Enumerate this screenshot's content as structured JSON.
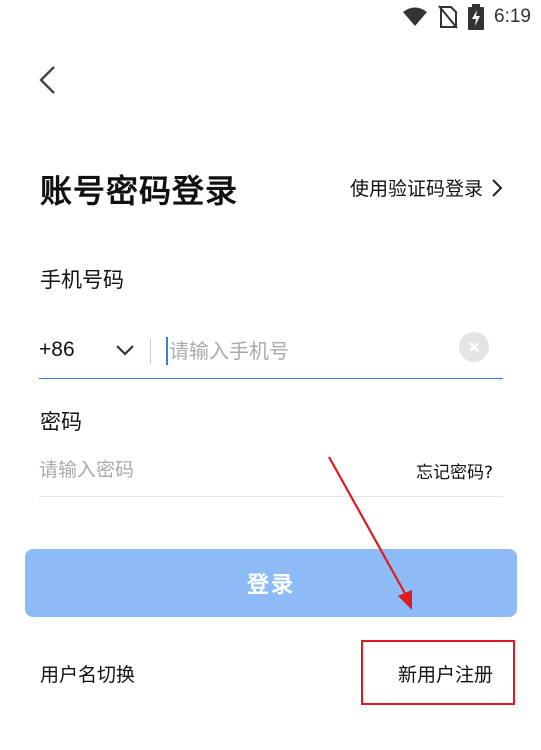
{
  "status_bar": {
    "time": "6:19"
  },
  "page": {
    "title": "账号密码登录",
    "alt_login": "使用验证码登录"
  },
  "phone": {
    "label": "手机号码",
    "country_code": "+86",
    "placeholder": "请输入手机号",
    "value": ""
  },
  "password": {
    "label": "密码",
    "placeholder": "请输入密码",
    "forgot": "忘记密码?"
  },
  "login_button": "登录",
  "footer": {
    "switch_user": "用户名切换",
    "register": "新用户注册"
  },
  "colors": {
    "accent": "#3b7dd8",
    "button_bg": "#8dbbf6",
    "annotation_red": "#e0181f"
  }
}
